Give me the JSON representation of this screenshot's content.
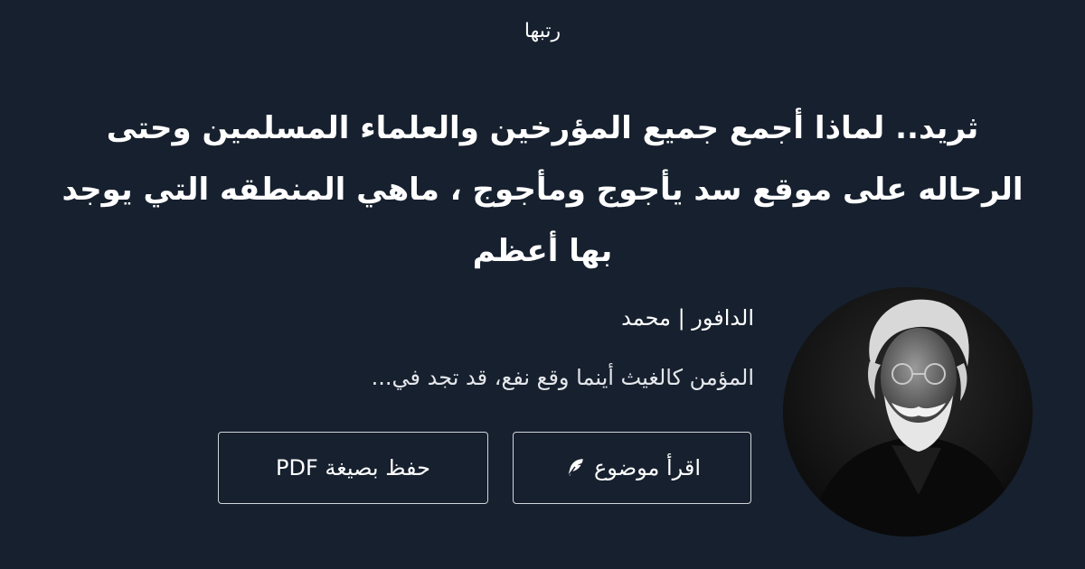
{
  "brand": {
    "name": "رتبها"
  },
  "article": {
    "title": "ثريد.. لماذا أجمع جميع المؤرخين والعلماء المسلمين وحتى الرحاله على موقع سد يأجوج ومأجوج ، ماهي المنطقه التي يوجد بها أعظم"
  },
  "author": {
    "name": "الدافور | محمد",
    "bio": "المؤمن كالغيث أينما وقع نفع، قد تجد في..."
  },
  "actions": {
    "read_label": "اقرأ موضوع",
    "read_icon": "feather-icon",
    "pdf_label": "حفظ بصيغة PDF"
  },
  "colors": {
    "background": "#16202e",
    "text": "#ffffff",
    "button_border": "#d1d5db"
  }
}
